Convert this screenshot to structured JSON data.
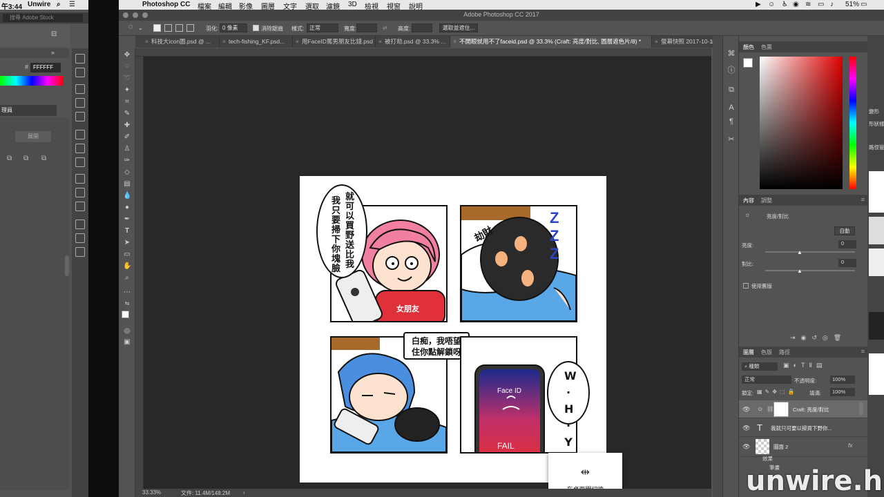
{
  "bg_window": {
    "clock": "午3:44",
    "app": "Unwire",
    "search_placeholder": "搜尋 Adobe Stock",
    "hex_value": "FFFFFF",
    "panel_label": "理員",
    "expand_label": "展開"
  },
  "menubar": {
    "app_name": "Photoshop CC",
    "items": [
      "檔案",
      "編輯",
      "影像",
      "圖層",
      "文字",
      "選取",
      "濾鏡",
      "3D",
      "檢視",
      "視窗",
      "說明"
    ],
    "battery": "51%"
  },
  "window_title": "Adobe Photoshop CC 2017",
  "options": {
    "feather_label": "羽化:",
    "feather_value": "0 像素",
    "antialias_label": "消除鋸齒",
    "style_label": "樣式:",
    "style_value": "正常",
    "width_label": "寬度:",
    "height_label": "高度:",
    "select_mask_button": "選取並遮住..."
  },
  "tabs": [
    {
      "label": "科技大icon圖.psd @ ..."
    },
    {
      "label": "tech-fishing_KF.psd..."
    },
    {
      "label": "用FaceID罵男朋友比錢.psd"
    },
    {
      "label": "被打劫.psd @ 33.3% ..."
    },
    {
      "label": "不開眼就用不了faceid.psd @ 33.3% (Craft: 亮度/對比, 圖層遮色片/8) *"
    },
    {
      "label": "螢幕快照 2017-10-1"
    }
  ],
  "status": {
    "zoom": "33.33%",
    "file_info": "文件: 11.4M/148.2M"
  },
  "comic": {
    "bubble1_col1": "我只要掃下你塊臉",
    "bubble1_col2": "就可以買野送比我",
    "shirt_text": "女朋友",
    "mask_text": "劫財",
    "zzz": "Z Z Z",
    "bubble2_line1": "白痴，我唔望",
    "bubble2_line2": "住你點解鎖呀",
    "why": "W·H·Y",
    "phone_faceid": "Face ID",
    "phone_fail": "FAIL"
  },
  "toast": {
    "label": "在桌面間切換"
  },
  "color_panel": {
    "tabs": [
      "顏色",
      "色票"
    ]
  },
  "properties_panel": {
    "tabs": [
      "內容",
      "調整"
    ],
    "type_label": "亮度/對比",
    "auto_button": "自動",
    "brightness_label": "亮度:",
    "brightness_value": "0",
    "contrast_label": "對比:",
    "contrast_value": "0",
    "legacy_label": "使用舊版"
  },
  "layers_panel": {
    "tabs": [
      "圖層",
      "色版",
      "路徑"
    ],
    "filter_label": "種類",
    "blend_mode": "正常",
    "opacity_label": "不透明度:",
    "opacity_value": "100%",
    "lock_label": "鎖定:",
    "fill_label": "填滿:",
    "fill_value": "100%",
    "layers": [
      {
        "name": "Craft: 亮度/對比"
      },
      {
        "name": "我就只可要以掃買下野你..."
      },
      {
        "name": "圖面 2"
      }
    ],
    "effects_label": "效果",
    "stroke_label": "筆畫"
  },
  "side_panel": {
    "shape_label": "變形",
    "style_label": "形狀樣式",
    "path_label": "路徑管理"
  },
  "watermark": "unwire.hk",
  "colors": {
    "accent_red": "#e0303a",
    "hair_pink": "#f07fa0",
    "hair_blue": "#5a9ee8"
  }
}
